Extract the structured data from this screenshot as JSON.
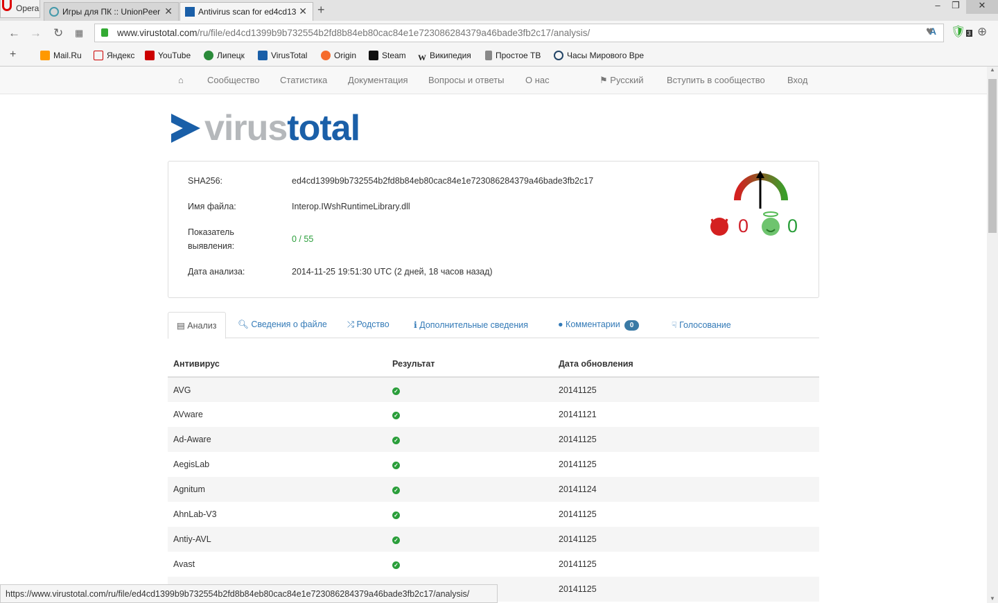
{
  "browser": {
    "app": "Opera",
    "tabs": [
      "Игры для ПК :: UnionPeer",
      "Antivirus scan for ed4cd13"
    ],
    "url_host": "www.virustotal.com",
    "url_path": "/ru/file/ed4cd1399b9b732554b2fd8b84eb80cac84e1e723086284379a46bade3fb2c17/analysis/",
    "extension_badge": "3",
    "bookmarks": [
      "Mail.Ru",
      "Яндекс",
      "YouTube",
      "Липецк",
      "VirusTotal",
      "Origin",
      "Steam",
      "Википедия",
      "Простое ТВ",
      "Часы Мирового Вре"
    ],
    "status_url": "https://www.virustotal.com/ru/file/ed4cd1399b9b732554b2fd8b84eb80cac84e1e723086284379a46bade3fb2c17/analysis/"
  },
  "nav": {
    "items": [
      "Сообщество",
      "Статистика",
      "Документация",
      "Вопросы и ответы",
      "О нас"
    ],
    "language": "Русский",
    "join": "Вступить в сообщество",
    "login": "Вход"
  },
  "logo": {
    "part1": "virus",
    "part2": "total"
  },
  "info": {
    "sha_label": "SHA256:",
    "sha": "ed4cd1399b9b732554b2fd8b84eb80cac84e1e723086284379a46bade3fb2c17",
    "name_label": "Имя файла:",
    "name": "Interop.IWshRuntimeLibrary.dll",
    "ratio_label1": "Показатель",
    "ratio_label2": "выявления:",
    "ratio": "0 / 55",
    "date_label": "Дата анализа:",
    "date": "2014-11-25 19:51:30 UTC (2 дней, 18 часов назад)",
    "malicious_votes": "0",
    "harmless_votes": "0"
  },
  "tabs": {
    "analysis": "Анализ",
    "file_info": "Сведения о файле",
    "relations": "Родство",
    "additional": "Дополнительные сведения",
    "comments": "Комментарии",
    "comments_count": "0",
    "votes": "Голосование"
  },
  "table": {
    "headers": [
      "Антивирус",
      "Результат",
      "Дата обновления"
    ],
    "rows": [
      [
        "AVG",
        "20141125"
      ],
      [
        "AVware",
        "20141121"
      ],
      [
        "Ad-Aware",
        "20141125"
      ],
      [
        "AegisLab",
        "20141125"
      ],
      [
        "Agnitum",
        "20141124"
      ],
      [
        "AhnLab-V3",
        "20141125"
      ],
      [
        "Antiy-AVL",
        "20141125"
      ],
      [
        "Avast",
        "20141125"
      ],
      [
        "",
        "20141125"
      ]
    ]
  },
  "colors": {
    "accent": "#337ab7",
    "clean": "#2a9e3a",
    "malicious": "#d0202a"
  }
}
